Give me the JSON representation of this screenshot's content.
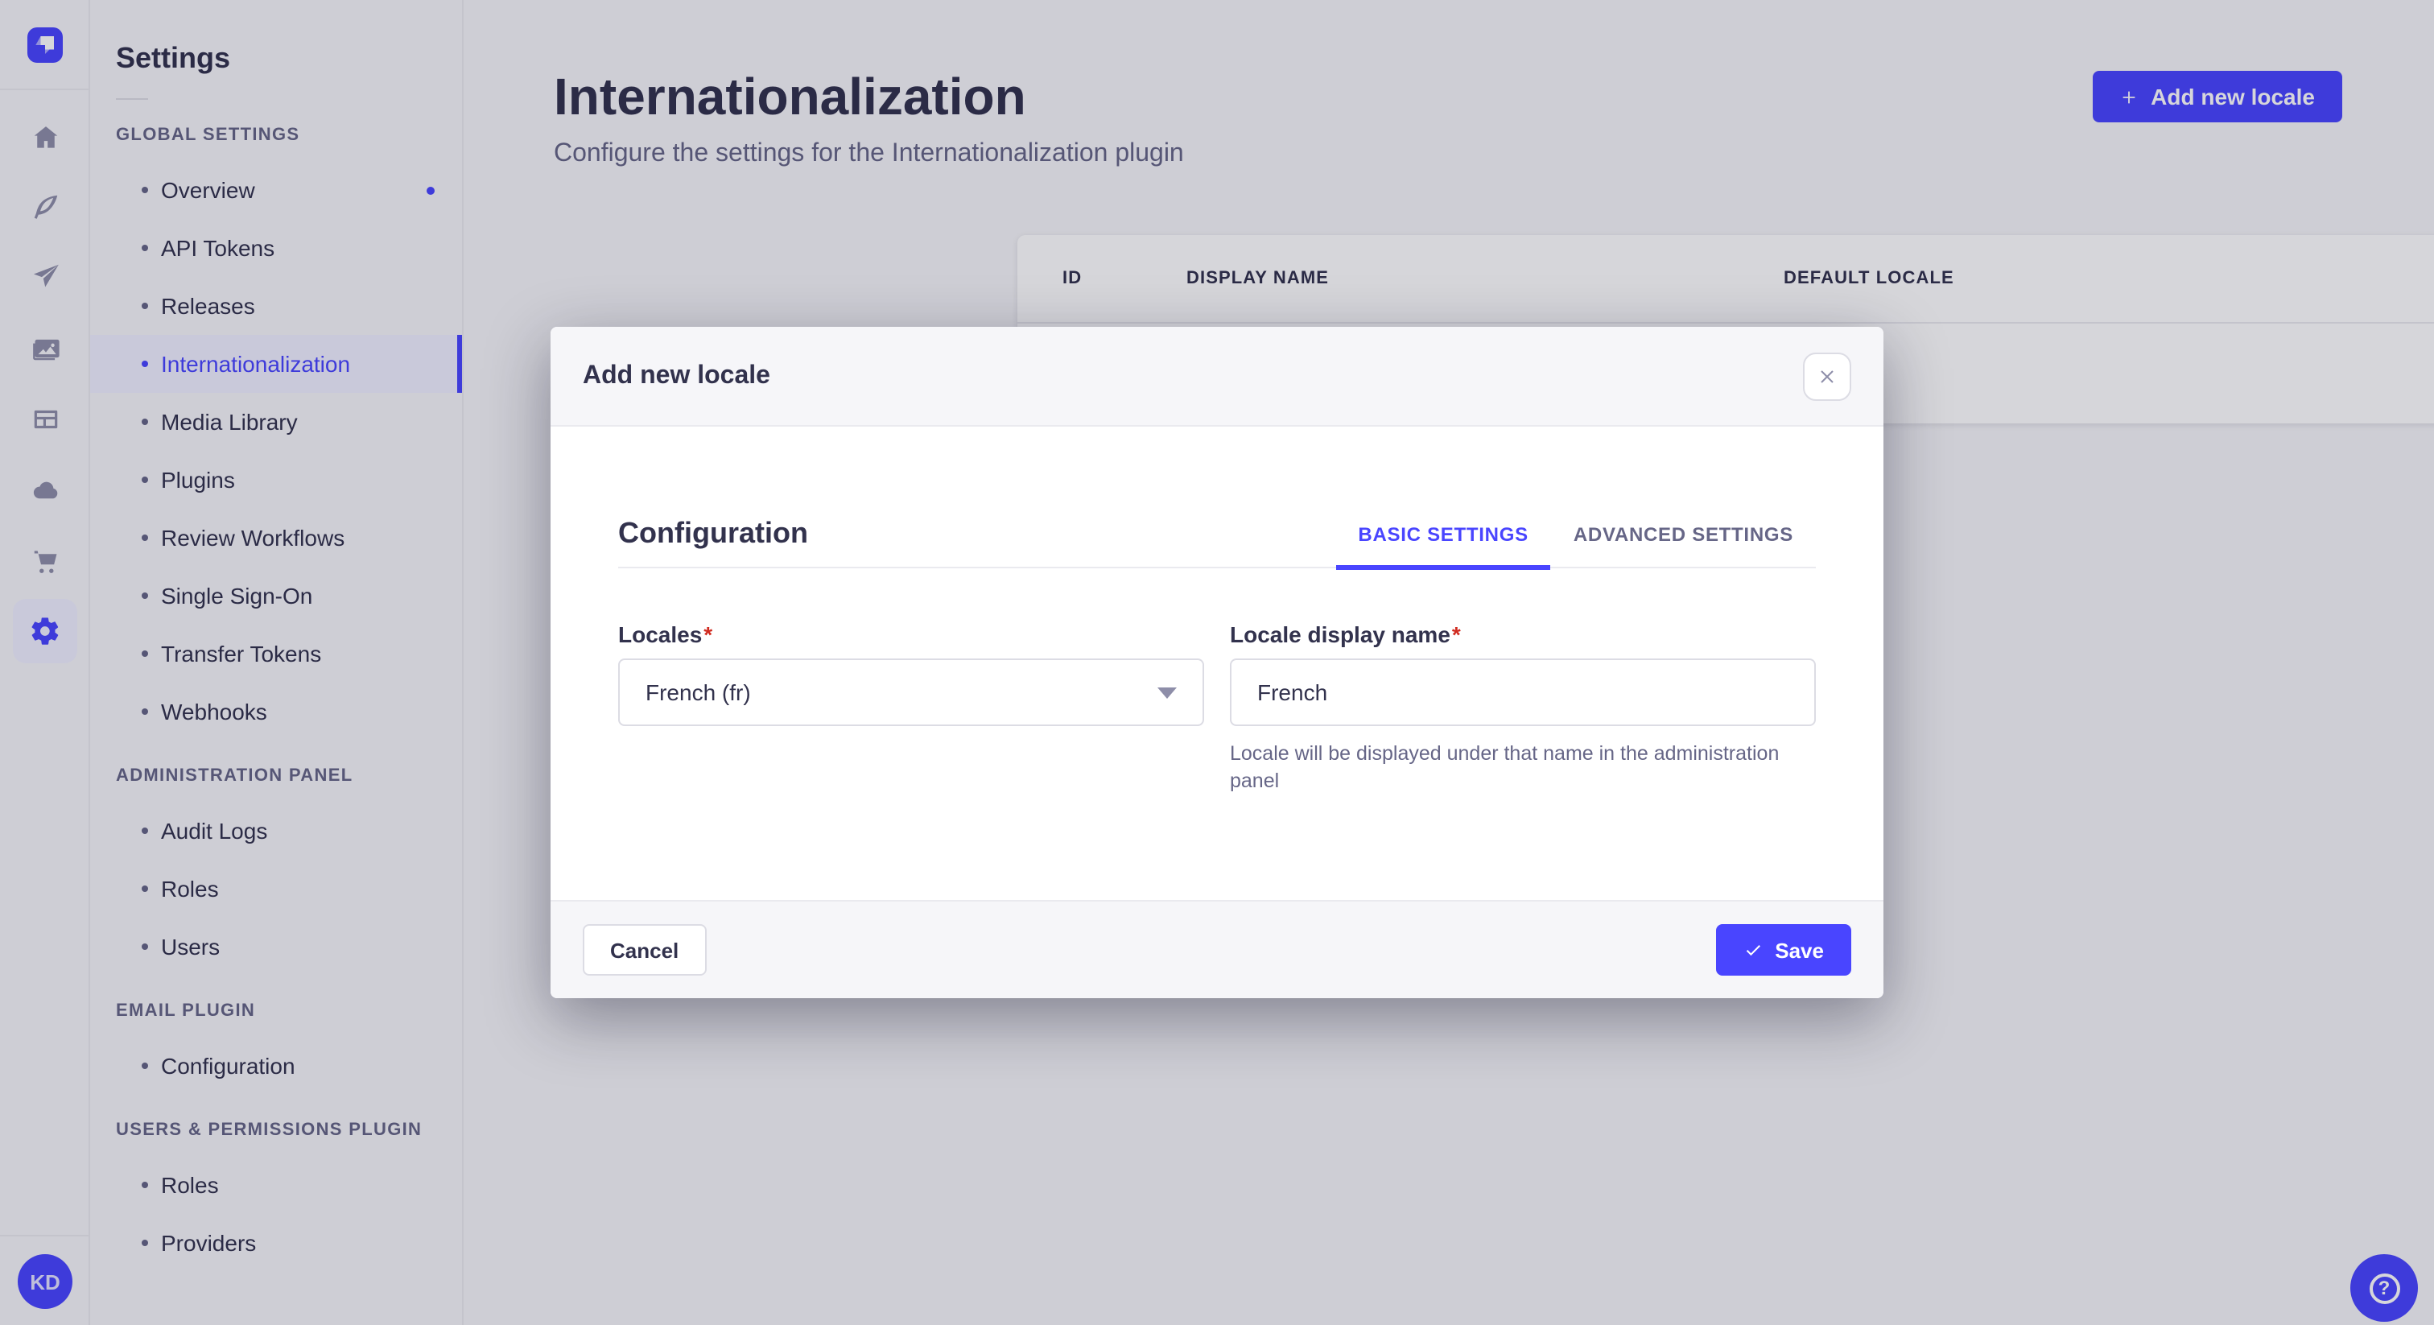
{
  "colors": {
    "accent": "#4945ff",
    "accent_soft": "#f0f0ff",
    "danger": "#d02b20",
    "text_dark": "#32324d",
    "text_muted": "#666687",
    "icon_gray": "#8e8ea9"
  },
  "rail": {
    "icons": [
      "strapi-logo",
      "home-icon",
      "feather-pen-icon",
      "paper-plane-icon",
      "pictures-icon",
      "layout-panel-icon",
      "cloud-icon",
      "shopping-cart-icon",
      "settings-gear-icon"
    ],
    "user_initials": "KD",
    "help_icon": "question-mark-circle-icon"
  },
  "sidebar": {
    "title": "Settings",
    "sections": [
      {
        "label": "GLOBAL SETTINGS",
        "items": [
          {
            "label": "Overview"
          },
          {
            "label": "API Tokens"
          },
          {
            "label": "Releases"
          },
          {
            "label": "Internationalization"
          },
          {
            "label": "Media Library"
          },
          {
            "label": "Plugins"
          },
          {
            "label": "Review Workflows"
          },
          {
            "label": "Single Sign-On"
          },
          {
            "label": "Transfer Tokens"
          },
          {
            "label": "Webhooks"
          }
        ]
      },
      {
        "label": "ADMINISTRATION PANEL",
        "items": [
          {
            "label": "Audit Logs"
          },
          {
            "label": "Roles"
          },
          {
            "label": "Users"
          }
        ]
      },
      {
        "label": "EMAIL PLUGIN",
        "items": [
          {
            "label": "Configuration"
          }
        ]
      },
      {
        "label": "USERS & PERMISSIONS PLUGIN",
        "items": [
          {
            "label": "Roles"
          },
          {
            "label": "Providers"
          }
        ]
      }
    ]
  },
  "header": {
    "title": "Internationalization",
    "subtitle": "Configure the settings for the Internationalization plugin",
    "add_button_label": "Add new locale"
  },
  "table": {
    "columns": [
      "ID",
      "DISPLAY NAME",
      "DEFAULT LOCALE"
    ],
    "row_action_icon": "edit-pencil-icon"
  },
  "modal": {
    "title": "Add new locale",
    "section_title": "Configuration",
    "tabs": [
      {
        "label": "BASIC SETTINGS"
      },
      {
        "label": "ADVANCED SETTINGS"
      }
    ],
    "required_mark": "*",
    "fields": {
      "locales": {
        "label": "Locales",
        "value": "French (fr)"
      },
      "display_name": {
        "label": "Locale display name",
        "value": "French",
        "hint": "Locale will be displayed under that name in the administration panel"
      }
    },
    "cancel_label": "Cancel",
    "save_label": "Save"
  }
}
